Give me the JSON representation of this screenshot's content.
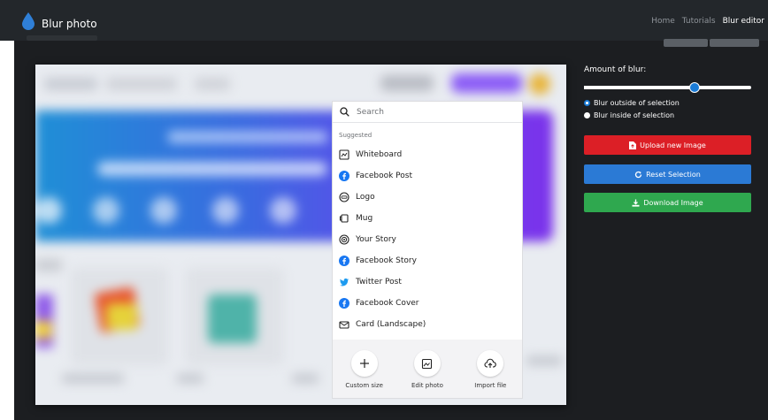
{
  "navbar": {
    "brand": "Blur photo",
    "links": [
      "Home",
      "Tutorials",
      "Blur editor"
    ]
  },
  "search": {
    "placeholder": "Search"
  },
  "menu": {
    "section_label": "Suggested",
    "items": [
      {
        "label": "Whiteboard",
        "icon": "whiteboard-icon"
      },
      {
        "label": "Facebook Post",
        "icon": "facebook-icon"
      },
      {
        "label": "Logo",
        "icon": "logo-icon"
      },
      {
        "label": "Mug",
        "icon": "mug-icon"
      },
      {
        "label": "Your Story",
        "icon": "story-icon"
      },
      {
        "label": "Facebook Story",
        "icon": "facebook-icon"
      },
      {
        "label": "Twitter Post",
        "icon": "twitter-icon"
      },
      {
        "label": "Facebook Cover",
        "icon": "facebook-icon"
      },
      {
        "label": "Card (Landscape)",
        "icon": "card-icon"
      }
    ],
    "tools": [
      {
        "label": "Custom size",
        "icon": "plus-icon"
      },
      {
        "label": "Edit photo",
        "icon": "edit-photo-icon"
      },
      {
        "label": "Import file",
        "icon": "cloud-upload-icon"
      }
    ]
  },
  "panel": {
    "blur_label": "Amount of blur:",
    "blur_amount": 0.66,
    "radio_outside": "Blur outside of selection",
    "radio_inside": "Blur inside of selection",
    "selected_radio": "outside",
    "upload_label": "Upload new Image",
    "reset_label": "Reset Selection",
    "download_label": "Download Image"
  },
  "colors": {
    "upload": "#dc1f26",
    "reset": "#2b7ad5",
    "download": "#2fa84f",
    "accent": "#1a7bd6"
  }
}
